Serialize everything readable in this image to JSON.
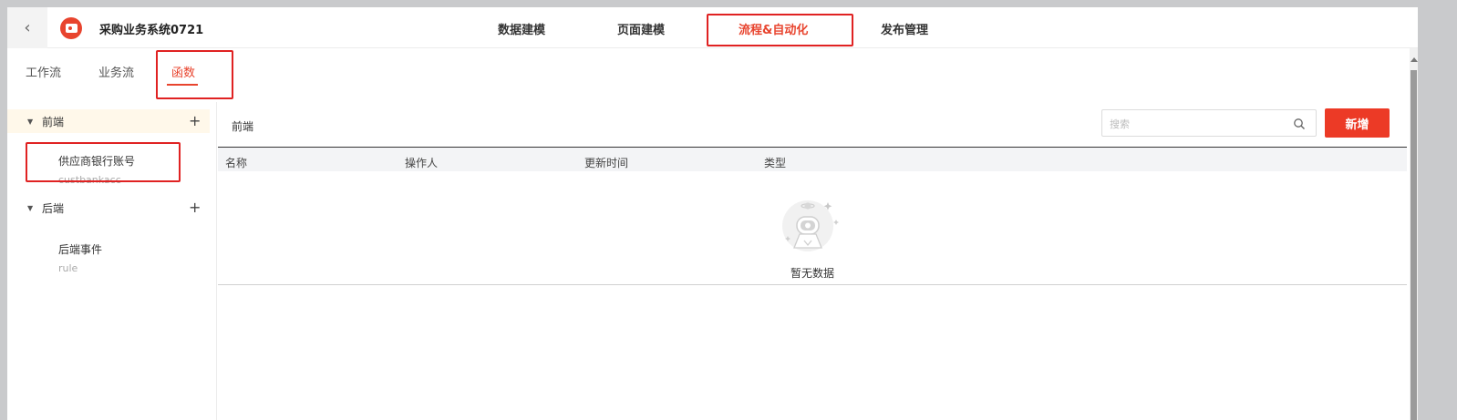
{
  "header": {
    "app_title": "采购业务系统0721",
    "nav": [
      {
        "label": "数据建模"
      },
      {
        "label": "页面建模"
      },
      {
        "label": "流程&自动化"
      },
      {
        "label": "发布管理"
      }
    ]
  },
  "subtabs": [
    {
      "label": "工作流"
    },
    {
      "label": "业务流"
    },
    {
      "label": "函数"
    }
  ],
  "sidebar": {
    "groups": [
      {
        "label": "前端",
        "items": [
          {
            "name": "供应商银行账号",
            "code": "custbankacc"
          }
        ]
      },
      {
        "label": "后端",
        "items": [
          {
            "name": "后端事件",
            "code": "rule"
          }
        ]
      }
    ]
  },
  "content": {
    "title": "前端",
    "search_placeholder": "搜索",
    "new_button": "新增",
    "columns": [
      "名称",
      "操作人",
      "更新时间",
      "类型"
    ],
    "empty_text": "暂无数据"
  },
  "colors": {
    "accent": "#e8442e",
    "primary_button": "#ec3a26",
    "highlight_box": "#e02222"
  }
}
